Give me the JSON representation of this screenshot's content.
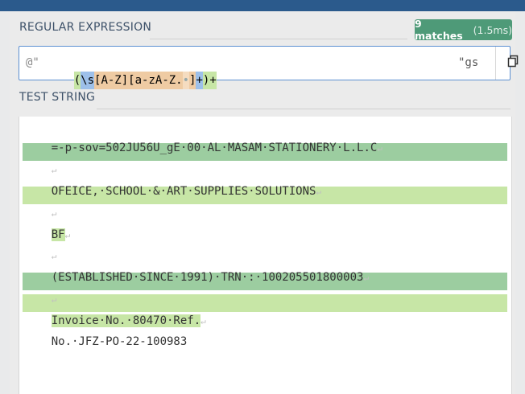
{
  "regex_section": {
    "title": "REGULAR EXPRESSION",
    "prefix": "@\"",
    "flags": "\"gs"
  },
  "matches_badge": {
    "count_text": "9 matches",
    "duration_text": "(1.5ms)",
    "color": "#4e9a78"
  },
  "regex_tokens": [
    "(",
    "\\s",
    "[A-Z]",
    "[a-zA-Z.",
    "•",
    "]",
    "+",
    ")+"
  ],
  "test_section": {
    "title": "TEST STRING"
  },
  "test_lines": [
    "=-p-sov=502JU56U_gE·00·AL·MASAM·STATIONERY·L.L.C",
    "",
    "OFEICE,·SCHOOL·&·ART·SUPPLIES·SOLUTIONS",
    "",
    "BF",
    "",
    "(ESTABLISHED·SINCE·1991)·TRN·:·100205501800003",
    "",
    "Invoice·No.·80470·Ref.",
    "No.·JFZ-PO-22-100983"
  ],
  "colors": {
    "match_light": "#c7e6a6",
    "match_dark": "#9ccda0",
    "regex_border": "#5d90d2",
    "header_bar": "#2b5a8c"
  },
  "icons": {
    "copy": "copy-icon",
    "newline": "newline-icon"
  }
}
